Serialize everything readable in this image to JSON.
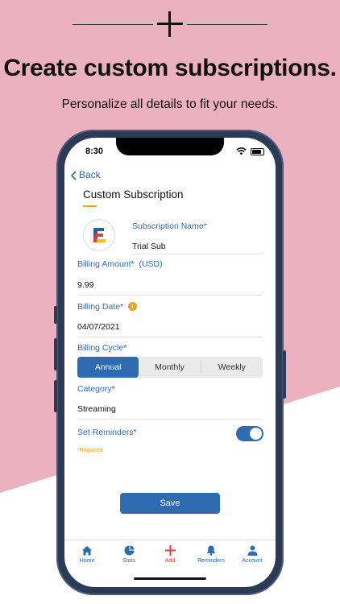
{
  "hero": {
    "title": "Create custom subscriptions.",
    "subtitle": "Personalize all details to fit your needs."
  },
  "status_bar": {
    "time": "8:30"
  },
  "nav": {
    "back_label": "Back"
  },
  "page": {
    "title": "Custom Subscription"
  },
  "form": {
    "name_label": "Subscription Name*",
    "name_value": "Trial Sub",
    "amount_label": "Billing Amount*  (USD)",
    "amount_value": "9.99",
    "date_label": "Billing Date*",
    "date_value": "04/07/2021",
    "cycle_label": "Billing Cycle*",
    "cycle_options": [
      "Annual",
      "Monthly",
      "Weekly"
    ],
    "cycle_selected": "Annual",
    "category_label": "Category*",
    "category_value": "Streaming",
    "reminders_label": "Set Reminders*",
    "reminders_on": true,
    "required_note": "*Required"
  },
  "save_label": "Save",
  "tabs": [
    {
      "label": "Home",
      "icon": "home-icon"
    },
    {
      "label": "Stats",
      "icon": "pie-chart-icon"
    },
    {
      "label": "Add",
      "icon": "plus-icon"
    },
    {
      "label": "Reminders",
      "icon": "bell-icon"
    },
    {
      "label": "Account",
      "icon": "person-icon"
    }
  ],
  "colors": {
    "background_pink": "#ebb1bf",
    "accent_blue": "#2e6bb0",
    "accent_orange": "#f0a020",
    "add_red": "#e23b3b",
    "phone_frame": "#2b3a55"
  }
}
